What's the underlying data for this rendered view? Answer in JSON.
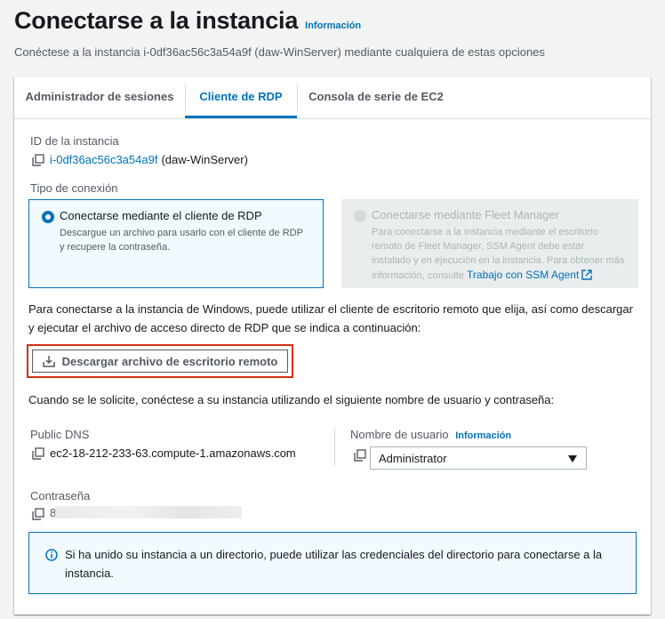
{
  "header": {
    "title": "Conectarse a la instancia",
    "info_link": "Información",
    "description": "Conéctese a la instancia i-0df36ac56c3a54a9f (daw-WinServer) mediante cualquiera de estas opciones"
  },
  "tabs": [
    {
      "label": "Administrador de sesiones"
    },
    {
      "label": "Cliente de RDP"
    },
    {
      "label": "Consola de serie de EC2"
    }
  ],
  "instance": {
    "label": "ID de la instancia",
    "id": "i-0df36ac56c3a54a9f",
    "name": "(daw-WinServer)"
  },
  "connection_type": {
    "label": "Tipo de conexión",
    "options": [
      {
        "title": "Conectarse mediante el cliente de RDP",
        "desc": "Descargue un archivo para usarlo con el cliente de RDP y recupere la contraseña."
      },
      {
        "title": "Conectarse mediante Fleet Manager",
        "desc": "Para conectarse a la instancia mediante el escritorio remoto de Fleet Manager, SSM Agent debe estar instalado y en ejecución en la instancia. Para obtener más información, consulte",
        "link": "Trabajo con SSM Agent"
      }
    ]
  },
  "instructions": "Para conectarse a la instancia de Windows, puede utilizar el cliente de escritorio remoto que elija, así como descargar y ejecutar el archivo de acceso directo de RDP que se indica a continuación:",
  "download_button": "Descargar archivo de escritorio remoto",
  "credentials_prompt": "Cuando se le solicite, conéctese a su instancia utilizando el siguiente nombre de usuario y contraseña:",
  "public_dns": {
    "label": "Public DNS",
    "value": "ec2-18-212-233-63.compute-1.amazonaws.com"
  },
  "username": {
    "label": "Nombre de usuario",
    "info_link": "Información",
    "selected": "Administrator"
  },
  "password": {
    "label": "Contraseña",
    "visible_char": "8"
  },
  "alert": {
    "text": "Si ha unido su instancia a un directorio, puede utilizar las credenciales del directorio para conectarse a la instancia."
  },
  "colors": {
    "accent": "#0073bb",
    "highlight_border": "#d13212",
    "background": "#f2f3f3"
  }
}
